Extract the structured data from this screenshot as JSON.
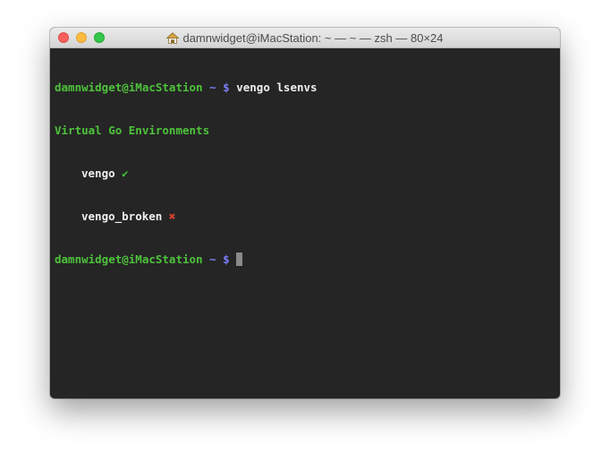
{
  "window": {
    "title": "damnwidget@iMacStation: ~ — ~ — zsh — 80×24"
  },
  "terminal": {
    "lines": [
      {
        "prompt_host": "damnwidget@iMacStation",
        "prompt_path": "~",
        "prompt_symbol": "$",
        "command": "vengo lsenvs"
      },
      {
        "header": "Virtual Go Environments"
      },
      {
        "env_name": "vengo",
        "status_mark": "✔"
      },
      {
        "env_name": "vengo_broken",
        "status_mark": "✖"
      },
      {
        "prompt_host": "damnwidget@iMacStation",
        "prompt_path": "~",
        "prompt_symbol": "$",
        "command": ""
      }
    ]
  },
  "colors": {
    "prompt_host": "#4ec23c",
    "prompt_symbol": "#7b7ff7",
    "check": "#41c23a",
    "cross": "#d9402f",
    "background": "#252525"
  }
}
